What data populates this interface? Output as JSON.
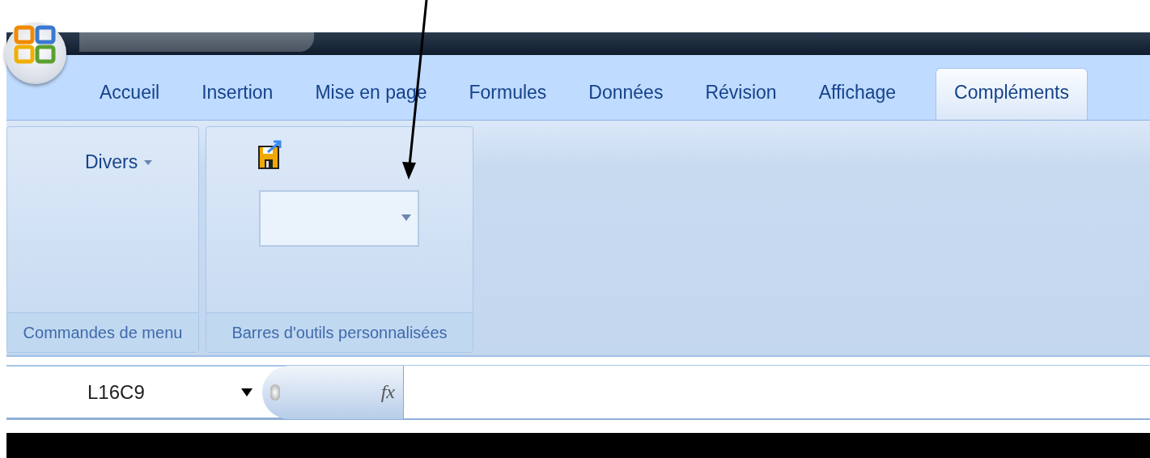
{
  "tabs": [
    {
      "label": "Accueil",
      "selected": false
    },
    {
      "label": "Insertion",
      "selected": false
    },
    {
      "label": "Mise en page",
      "selected": false
    },
    {
      "label": "Formules",
      "selected": false
    },
    {
      "label": "Données",
      "selected": false
    },
    {
      "label": "Révision",
      "selected": false
    },
    {
      "label": "Affichage",
      "selected": false
    },
    {
      "label": "Compléments",
      "selected": true
    }
  ],
  "groups": [
    {
      "kind": "menu",
      "label": "Commandes de menu",
      "button": "Divers"
    },
    {
      "kind": "toolbar",
      "label": "Barres d'outils personnalisées"
    }
  ],
  "formula_bar": {
    "name_box": "L16C9",
    "function_button": "fx"
  }
}
